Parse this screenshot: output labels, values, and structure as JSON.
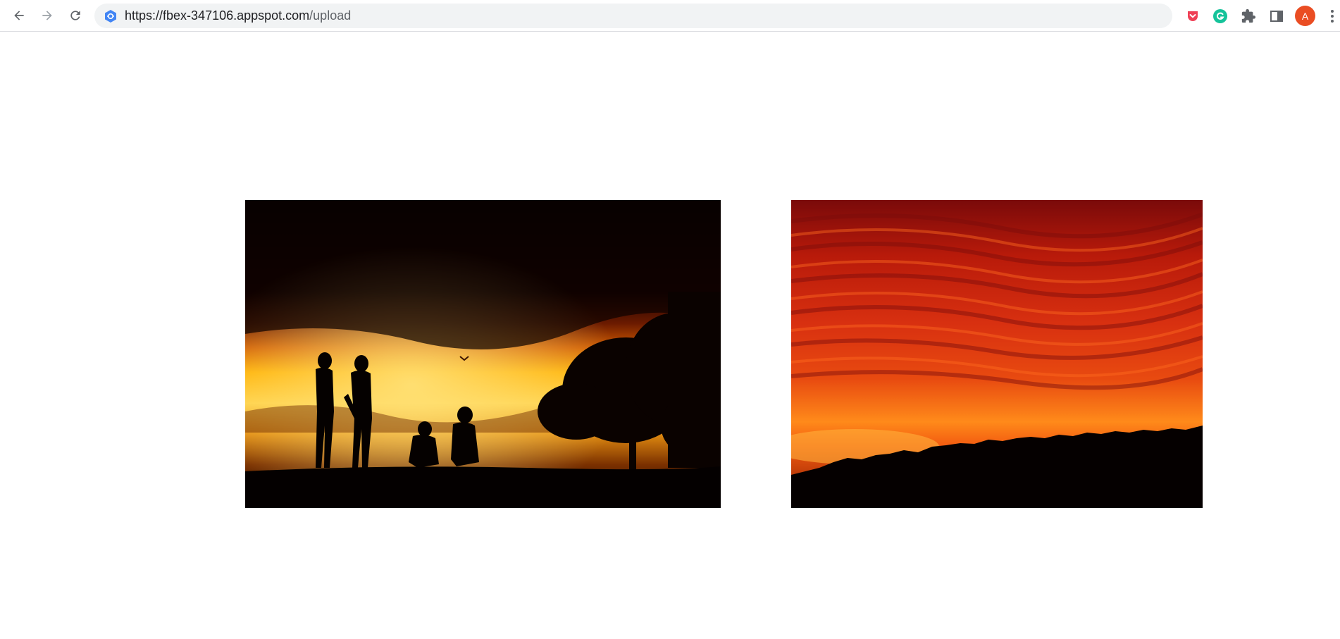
{
  "browser": {
    "url_host": "https://fbex-347106.appspot.com",
    "url_path": "/upload",
    "profile_initial": "A",
    "icons": {
      "back": "back-arrow-icon",
      "forward": "forward-arrow-icon",
      "reload": "reload-icon",
      "site": "app-engine-site-icon",
      "pocket": "pocket-extension-icon",
      "grammarly": "grammarly-extension-icon",
      "extensions": "puzzle-piece-icon",
      "side_panel": "side-panel-icon",
      "menu": "kebab-menu-icon"
    },
    "colors": {
      "avatar": "#ea4d23",
      "pocket": "#ef4056",
      "grammarly": "#15c39a",
      "site_icon": "#4285f4"
    }
  },
  "page": {
    "images": [
      {
        "name": "silhouettes-at-sunset-photo",
        "description_icon": "sunset-silhouette-image"
      },
      {
        "name": "red-sky-sunset-photo",
        "description_icon": "red-sky-image"
      }
    ]
  }
}
